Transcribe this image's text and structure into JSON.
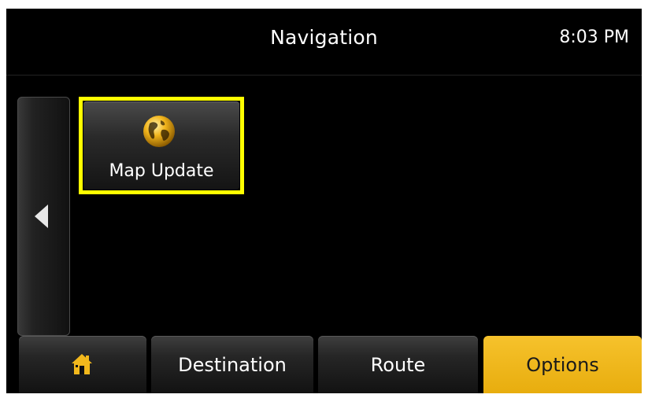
{
  "header": {
    "title": "Navigation",
    "time": "8:03 PM"
  },
  "sidebar": {
    "back_icon": "left-arrow-icon"
  },
  "menu": {
    "tiles": [
      {
        "label": "Map Update",
        "icon": "globe-icon",
        "highlighted": true
      }
    ]
  },
  "tabs": {
    "home_icon": "home-icon",
    "items": [
      {
        "label": "Destination",
        "active": false
      },
      {
        "label": "Route",
        "active": false
      },
      {
        "label": "Options",
        "active": true
      }
    ]
  },
  "colors": {
    "background": "#000000",
    "active_tab": "#f2b81c",
    "highlight": "#ffff00",
    "icon_gold": "#f0b000"
  }
}
